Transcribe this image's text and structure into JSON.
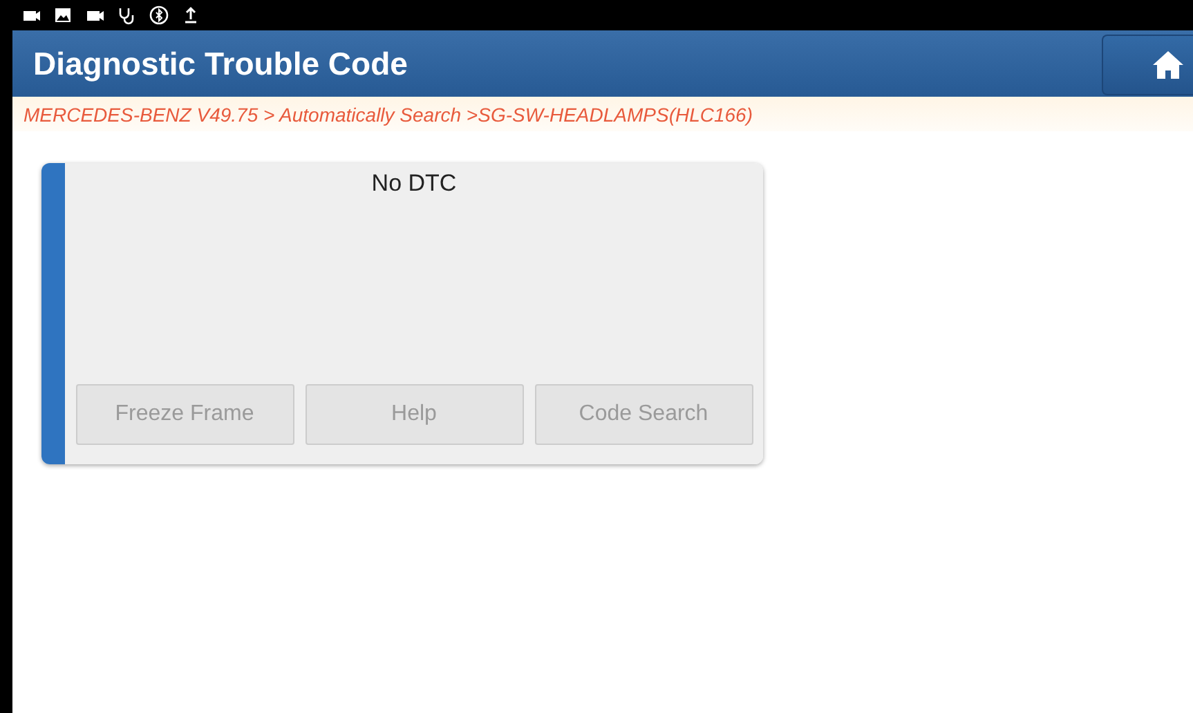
{
  "header": {
    "title": "Diagnostic Trouble Code"
  },
  "breadcrumb": "MERCEDES-BENZ V49.75 > Automatically Search >SG-SW-HEADLAMPS(HLC166)",
  "dtc_card": {
    "message": "No DTC",
    "buttons": [
      {
        "label": "Freeze Frame",
        "disabled": true
      },
      {
        "label": "Help",
        "disabled": true
      },
      {
        "label": "Code Search",
        "disabled": true
      }
    ]
  }
}
